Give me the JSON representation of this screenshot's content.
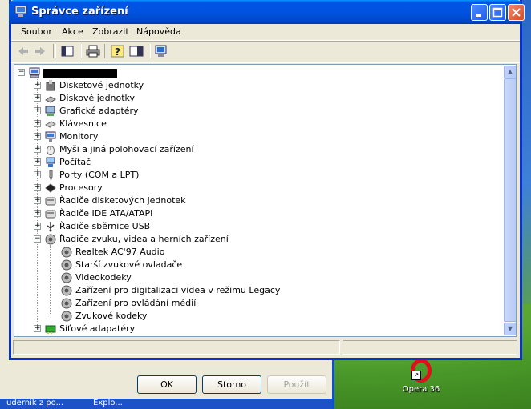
{
  "window": {
    "title": "Správce zařízení"
  },
  "menu": [
    "Soubor",
    "Akce",
    "Zobrazit",
    "Nápověda"
  ],
  "toolbar": [
    "back-icon",
    "forward-icon",
    "properties-icon",
    "print-icon",
    "help-icon",
    "show-hide-icon",
    "scan-hardware-icon"
  ],
  "tree": {
    "categories": [
      {
        "label": "Disketové jednotky"
      },
      {
        "label": "Diskové jednotky"
      },
      {
        "label": "Grafické adaptéry"
      },
      {
        "label": "Klávesnice"
      },
      {
        "label": "Monitory"
      },
      {
        "label": "Myši a jiná polohovací zařízení"
      },
      {
        "label": "Počítač"
      },
      {
        "label": "Porty (COM a LPT)"
      },
      {
        "label": "Procesory"
      },
      {
        "label": "Řadiče disketových jednotek"
      },
      {
        "label": "Řadiče IDE ATA/ATAPI"
      },
      {
        "label": "Řadiče sběrnice USB"
      },
      {
        "label": "Řadiče zvuku, videa a herních zařízení"
      },
      {
        "label": "Síťové adapatéry"
      }
    ],
    "sound_children": [
      {
        "label": "Realtek AC'97 Audio"
      },
      {
        "label": "Starší zvukové ovladače"
      },
      {
        "label": "Videokodeky"
      },
      {
        "label": "Zařízení pro digitalizaci videa v režimu Legacy"
      },
      {
        "label": "Zařízení pro ovládání médií"
      },
      {
        "label": "Zvukové kodeky"
      }
    ]
  },
  "dialog": {
    "ok": "OK",
    "cancel": "Storno",
    "apply": "Použít"
  },
  "taskbar": [
    "udernik z po...",
    "Explo..."
  ],
  "desktop": {
    "opera_label": "Opera 36"
  },
  "colors": {
    "titlebar": "#0055e5",
    "desktop": "#3a6ea5",
    "close": "#d94a22"
  }
}
